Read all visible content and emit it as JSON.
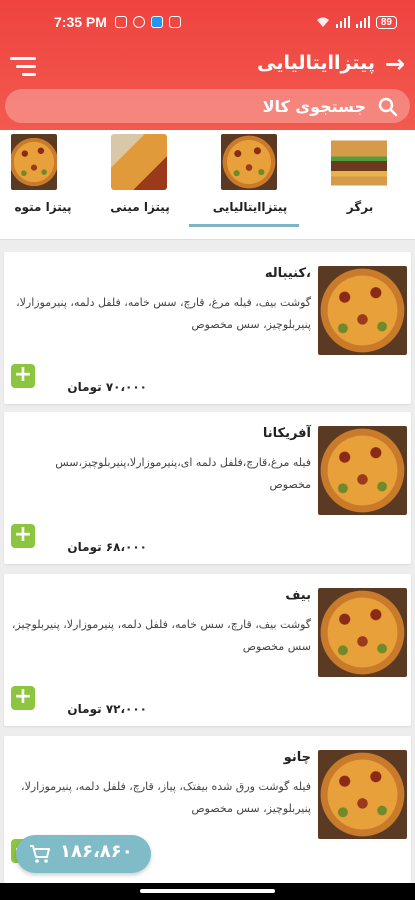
{
  "status_bar": {
    "time": "7:35 PM",
    "battery": "89"
  },
  "header": {
    "title": "پیتزاایتالیایی",
    "back_icon": "arrow-right-icon",
    "menu_icon": "hamburger-menu-icon"
  },
  "search": {
    "placeholder": "جستجوی کالا"
  },
  "categories": [
    {
      "label": "برگر",
      "icon": "burger-image"
    },
    {
      "label": "پیتزاایتالیایی",
      "icon": "pizza-image",
      "selected": true
    },
    {
      "label": "پیتزا مینی",
      "icon": "pizza-slice-image"
    },
    {
      "label": "پیتزا متوه",
      "icon": "pizza-image"
    }
  ],
  "products": [
    {
      "title": "،کنیباله",
      "description": "گوشت بیف، فیله مرغ، قارچ، سس خامه، فلفل دلمه، پنیرموزارلا، پنیربلوچیز، سس مخصوص",
      "price": "۷۰،۰۰۰ تومان"
    },
    {
      "title": "آفریکانا",
      "description": "فیله مرغ،قارچ،فلفل دلمه ای،پنیرموزارلا،پنیربلوچیز،سس مخصوص",
      "price": "۶۸،۰۰۰ تومان"
    },
    {
      "title": "بیف",
      "description": "گوشت بیف، قارچ، سس خامه، فلفل دلمه، پنیرموزارلا، پنیربلوچیز، سس مخصوص",
      "price": "۷۲،۰۰۰ تومان"
    },
    {
      "title": "چانو",
      "description": "فیله گوشت ورق شده بیفتک، پیاز، قارچ، فلفل دلمه، پنیرموزارلا، پنیربلوچیز، سس مخصوص",
      "price": ""
    }
  ],
  "cart": {
    "total": "۱۸۶،۸۶۰"
  },
  "colors": {
    "header": "#ef4340",
    "add_button": "#8cc63f",
    "cart_fab": "#7fbcc8",
    "tab_underline": "#7fb3c6"
  }
}
